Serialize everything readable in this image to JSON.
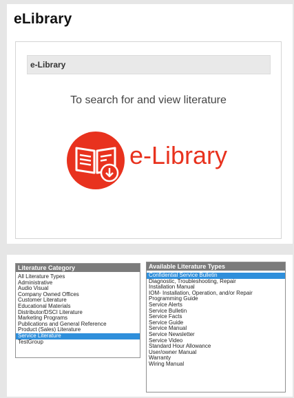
{
  "top_panel": {
    "title": "eLibrary",
    "card_header": "e-Library",
    "instruction": "To search for and view literature",
    "logo_text": "e-Library",
    "logo_icon": "book-download-icon",
    "accent_color": "#e8321e"
  },
  "literature_category": {
    "header": "Literature Category",
    "items": [
      "All Literature Types",
      "Administrative",
      "Audio Visual",
      "Company Owned Offices",
      "Customer Literature",
      "Educational Materials",
      "Distributor/DSCI Literature",
      "Marketing Programs",
      "Publications and General Reference",
      "Product (Sales) Literature",
      "Service Literature",
      "TestGroup"
    ],
    "selected": "Service Literature"
  },
  "available_types": {
    "header": "Available Literature Types",
    "items": [
      "Confidential Service Bulletin",
      "Diagnostic, Troubleshooting, Repair",
      "Installation Manual",
      "IOM- Installation, Operation, and/or Repair",
      "Programming Guide",
      "Service Alerts",
      "Service Bulletin",
      "Service Facts",
      "Service Guide",
      "Service Manual",
      "Service Newsletter",
      "Service Video",
      "Standard Hour Allowance",
      "User/owner Manual",
      "Warranty",
      "Wiring Manual"
    ],
    "selected": "Confidential Service Bulletin"
  },
  "selection_color": "#2f8fdb"
}
